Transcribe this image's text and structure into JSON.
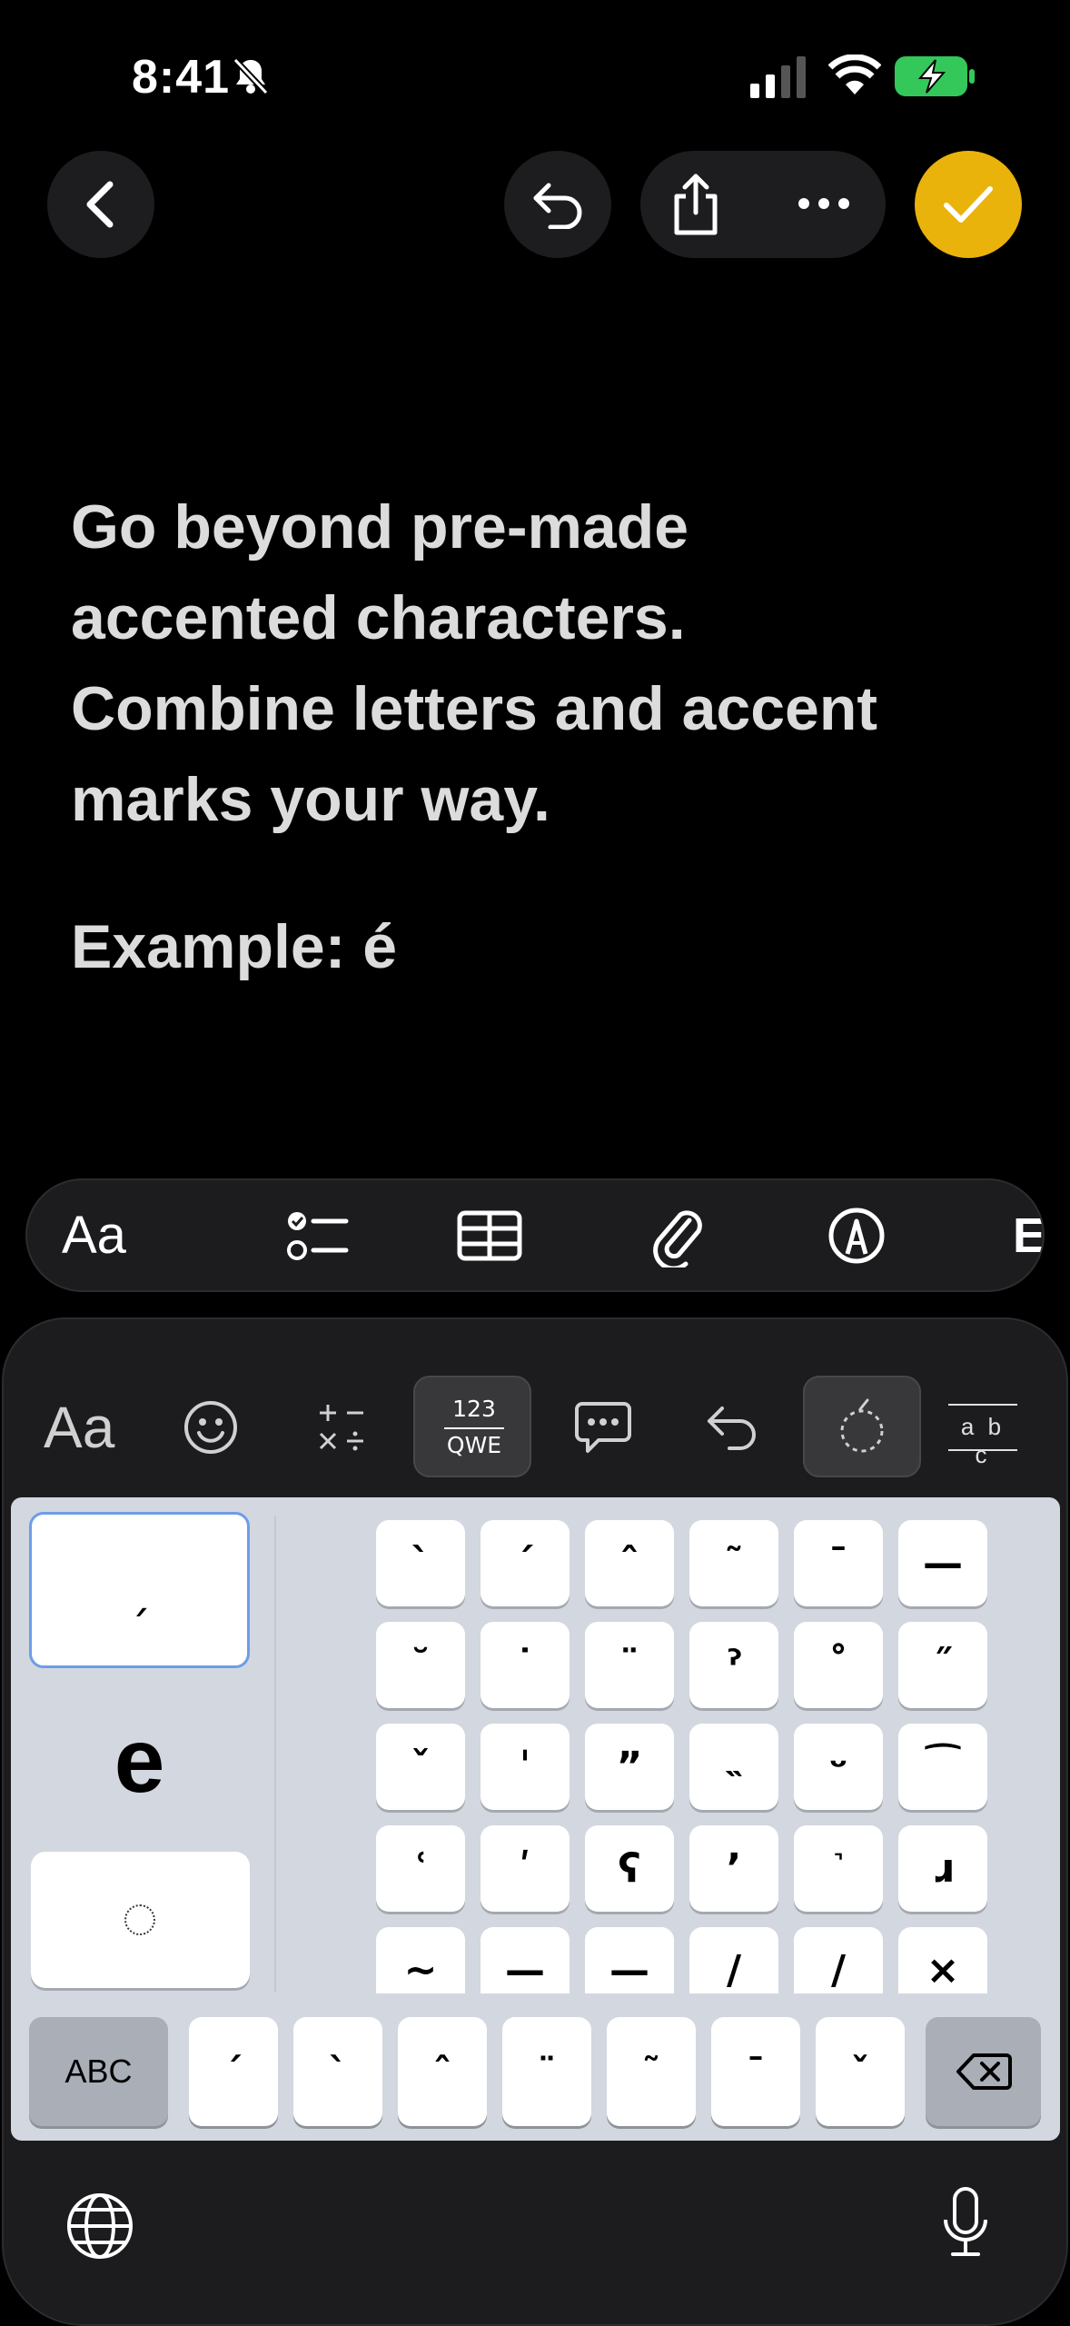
{
  "status_bar": {
    "time": "8:41",
    "icons": [
      "bell-slash-icon",
      "cellular-signal-icon",
      "wifi-icon",
      "battery-charging-icon"
    ]
  },
  "nav": {
    "back": "chevron-left-icon",
    "undo": "undo-icon",
    "share": "share-icon",
    "more": "ellipsis-icon",
    "done": "checkmark-icon"
  },
  "note": {
    "line1": "Go beyond pre-made",
    "line2": "accented characters.",
    "line3": "Combine letters and accent",
    "line4": "marks your way.",
    "example": "Example: é"
  },
  "format_toolbar": {
    "text_style": "Aa",
    "items": [
      "checklist-icon",
      "table-icon",
      "attachment-icon",
      "markup-icon"
    ],
    "clipped_item": "E"
  },
  "keyboard_toolbar": {
    "font_button": "Aa",
    "mode_top": "123",
    "mode_bottom": "QWE",
    "lowercase_label": "a b c",
    "items": [
      "emoji-icon",
      "math-symbols-icon",
      "keyboard-mode-icon",
      "speech-bubble-icon",
      "undo-icon",
      "combining-mark-icon",
      "lowercase-icon"
    ]
  },
  "composer": {
    "preview": "ˏ",
    "base_letter": "e",
    "placeholder": "dotted-circle-icon"
  },
  "marks": [
    [
      "ˋ",
      "ˊ",
      "ˆ",
      "˜",
      "ˉ",
      "—"
    ],
    [
      "˘",
      "˙",
      "¨",
      "ˀ",
      "˚",
      "˝"
    ],
    [
      "ˇ",
      "ˈ",
      "ˮ",
      "˵",
      "ᵕ",
      "⁀"
    ],
    [
      "ʿ",
      "ʹ",
      "ʕ",
      "ʼ",
      "˺",
      "ɹ"
    ],
    [
      "~",
      "—",
      "—",
      "/",
      "/",
      "×"
    ]
  ],
  "bottom_row": {
    "abc": "ABC",
    "keys": [
      "ˊ",
      "ˋ",
      "ˆ",
      "¨",
      "˜",
      "ˉ",
      "ˇ"
    ],
    "delete": "delete-icon"
  },
  "bottom_bar": {
    "globe": "globe-icon",
    "mic": "microphone-icon"
  },
  "colors": {
    "done": "#e9b30c",
    "battery": "#34c759",
    "preview_border": "#6e9de8"
  }
}
